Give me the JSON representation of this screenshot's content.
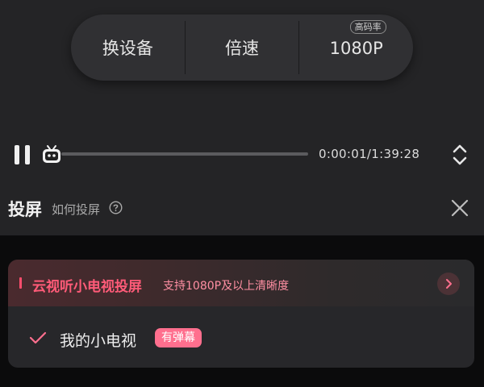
{
  "controls": {
    "switch_device": "换设备",
    "speed": "倍速",
    "quality": "1080P",
    "quality_badge": "高码率"
  },
  "playback": {
    "progress_fraction": 0.0002,
    "time": "0:00:01/1:39:28",
    "state": "playing"
  },
  "cast": {
    "title": "投屏",
    "help_text": "如何投屏"
  },
  "cloud_cast": {
    "title": "云视听小电视投屏",
    "subtitle": "支持1080P及以上清晰度",
    "accent_color": "#ff5b78"
  },
  "devices": [
    {
      "name": "我的小电视",
      "badge": "有弹幕",
      "selected": true
    }
  ],
  "icons": {
    "pause": "pause-icon",
    "mascot": "bilibili-tv-icon",
    "expand": "expand-collapse-icon",
    "help": "question-circle-icon",
    "close": "close-icon",
    "chevron": "chevron-right-icon",
    "check": "checkmark-icon"
  },
  "colors": {
    "brand_pink": "#ff6f8e"
  }
}
